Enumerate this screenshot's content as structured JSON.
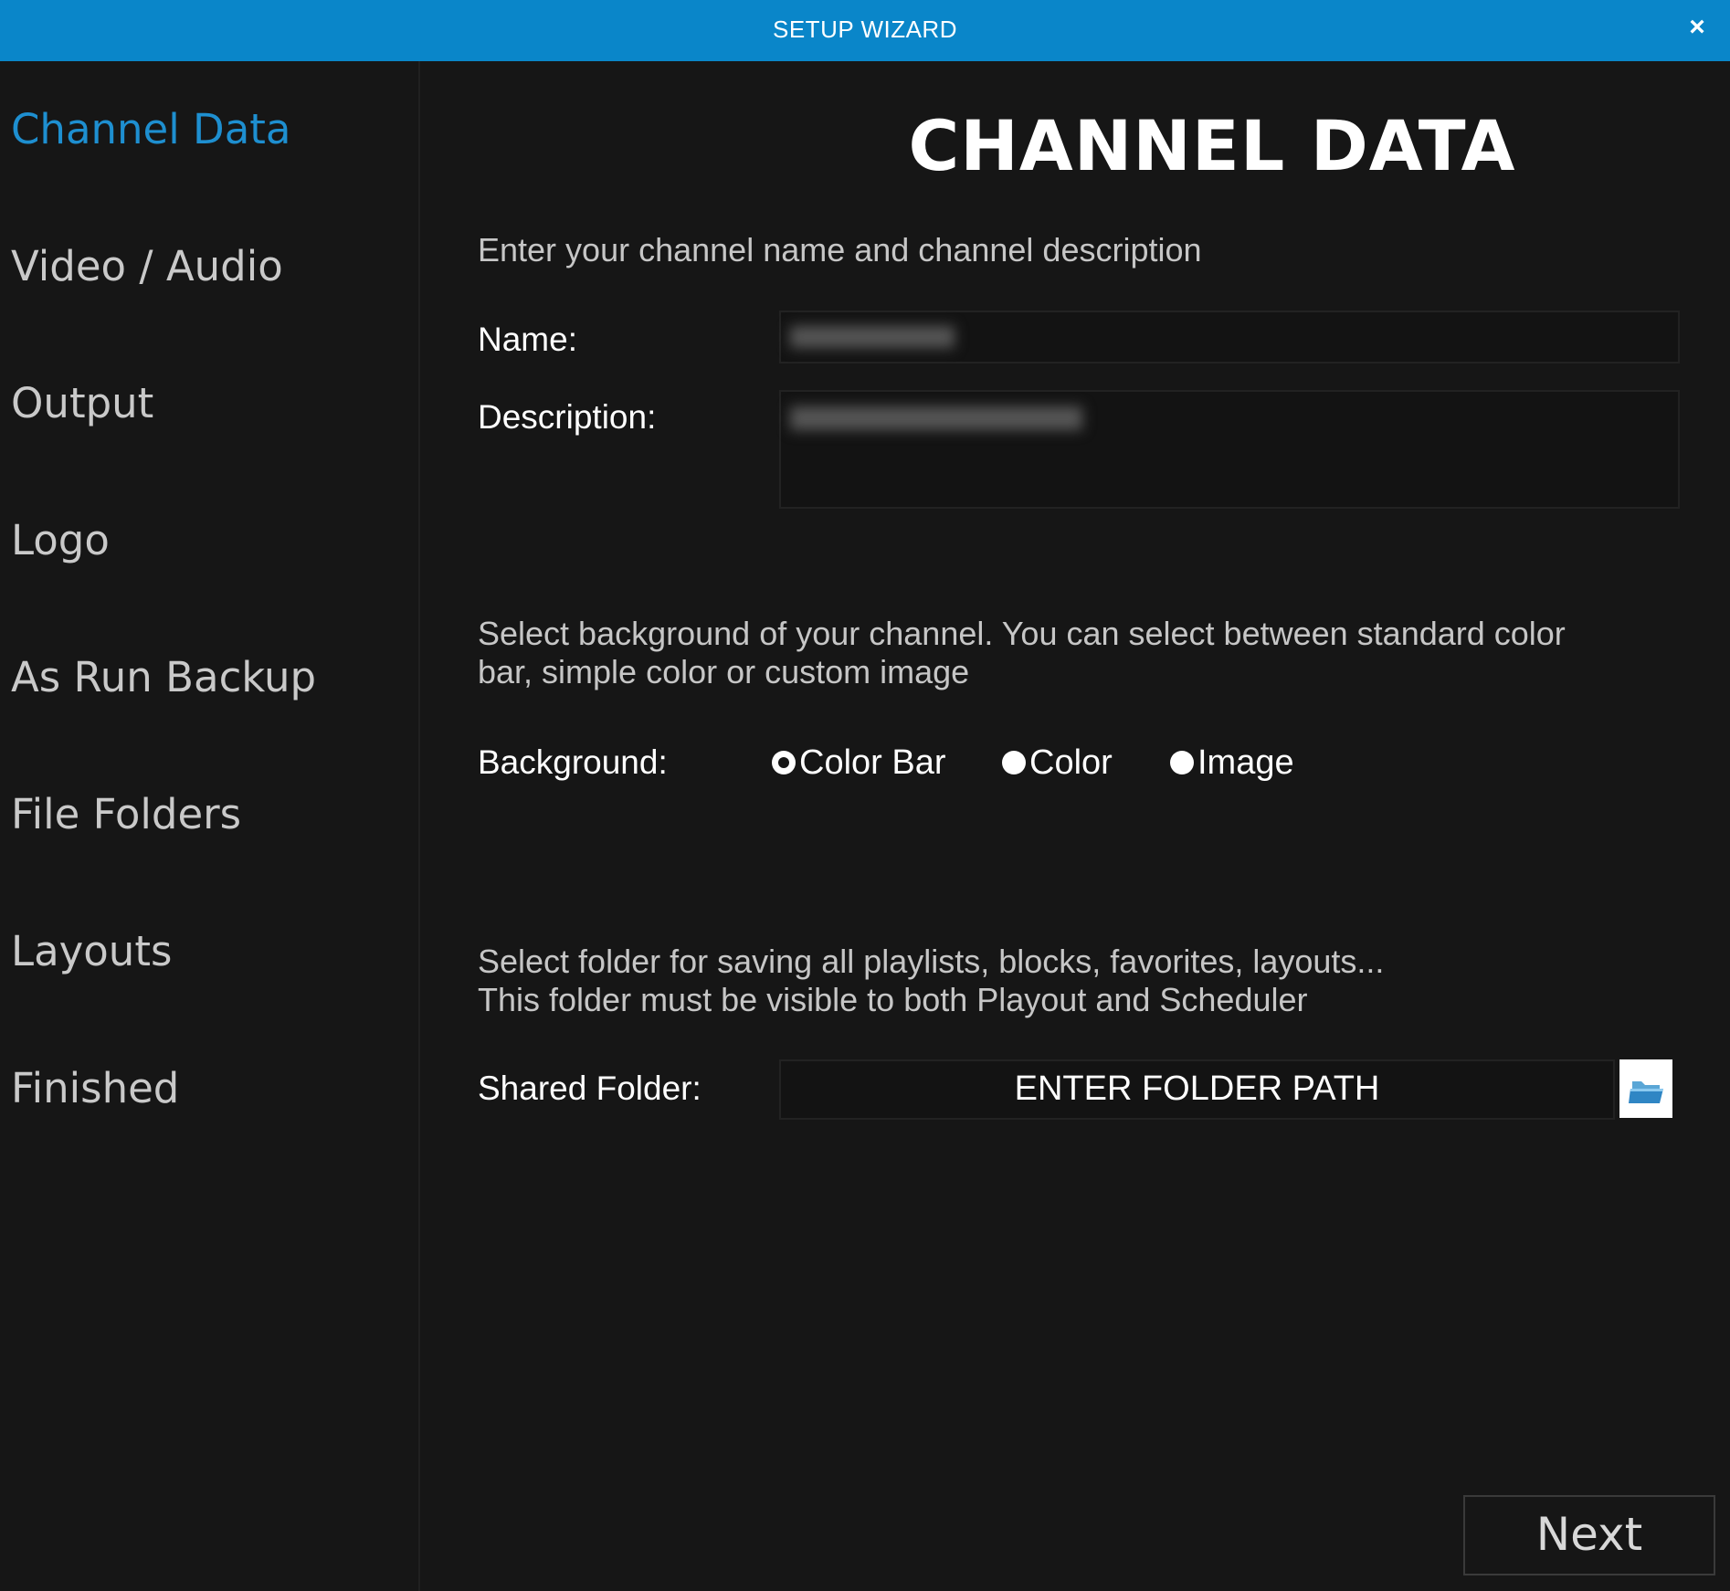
{
  "window": {
    "title": "SETUP WIZARD",
    "close_glyph": "×"
  },
  "sidebar": {
    "items": [
      {
        "label": "Channel Data",
        "active": true
      },
      {
        "label": "Video / Audio",
        "active": false
      },
      {
        "label": "Output",
        "active": false
      },
      {
        "label": "Logo",
        "active": false
      },
      {
        "label": "As Run Backup",
        "active": false
      },
      {
        "label": "File Folders",
        "active": false
      },
      {
        "label": "Layouts",
        "active": false
      },
      {
        "label": "Finished",
        "active": false
      }
    ]
  },
  "main": {
    "heading": "CHANNEL DATA",
    "channel_desc": "Enter your channel name and channel description",
    "name_label": "Name:",
    "name_value": "",
    "description_label": "Description:",
    "description_value": "",
    "background_desc": "Select background of your channel. You can select between standard color\nbar, simple color or custom image",
    "background_label": "Background:",
    "background_options": [
      {
        "label": "Color Bar",
        "checked": true
      },
      {
        "label": "Color",
        "checked": false
      },
      {
        "label": "Image",
        "checked": false
      }
    ],
    "folder_desc": "Select folder for saving all playlists, blocks, favorites, layouts...\nThis folder must be visible to both Playout and Scheduler",
    "shared_folder_label": "Shared Folder:",
    "shared_folder_placeholder": "ENTER FOLDER PATH",
    "browse_icon": "folder-icon",
    "next_label": "Next"
  },
  "colors": {
    "accent": "#0a86c9",
    "active_item": "#1e8fd0",
    "background": "#161616"
  }
}
